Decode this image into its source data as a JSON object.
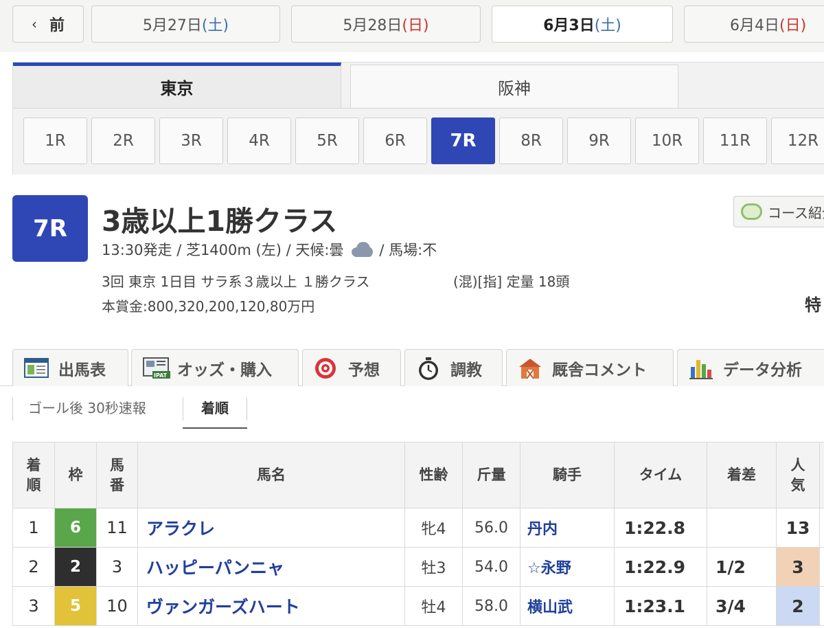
{
  "date_nav": {
    "prev_label": "前",
    "dates": [
      {
        "date": "5月27日",
        "day": "(土)",
        "day_type": "sat"
      },
      {
        "date": "5月28日",
        "day": "(日)",
        "day_type": "sun"
      },
      {
        "date": "6月3日",
        "day": "(土)",
        "day_type": "sat",
        "active": true
      },
      {
        "date": "6月4日",
        "day": "(日)",
        "day_type": "sun"
      }
    ]
  },
  "venues": [
    {
      "label": "東京",
      "active": true
    },
    {
      "label": "阪神",
      "active": false
    }
  ],
  "races": [
    "1R",
    "2R",
    "3R",
    "4R",
    "5R",
    "6R",
    "7R",
    "8R",
    "9R",
    "10R",
    "11R",
    "12R"
  ],
  "active_race": "7R",
  "race": {
    "number": "7R",
    "name": "3歳以上1勝クラス",
    "info_left": "13:30発走 / 芝1400m (左) / 天候:曇",
    "info_right": "/ 馬場:不",
    "detail": "3回 東京 1日目 サラ系３歳以上 １勝クラス",
    "detail_group": "(混)[指] 定量 18頭",
    "prize": "本賞金:800,320,200,120,80万円",
    "course_label": "コース紹介",
    "extra_label": "特",
    "weather_icon": "cloud-icon"
  },
  "function_tabs": [
    {
      "label": "出馬表",
      "icon": "card-icon"
    },
    {
      "label": "オッズ・購入",
      "icon": "ipat-icon"
    },
    {
      "label": "予想",
      "icon": "target-icon"
    },
    {
      "label": "調教",
      "icon": "stopwatch-icon"
    },
    {
      "label": "厩舎コメント",
      "icon": "stable-icon"
    },
    {
      "label": "データ分析",
      "icon": "bar-chart-icon"
    }
  ],
  "sub_tabs": {
    "first": "ゴール後 30秒速報",
    "second": "着順"
  },
  "table": {
    "headers": {
      "rank": "着\n順",
      "waku": "枠",
      "number": "馬\n番",
      "horse": "馬名",
      "sex_age": "性齢",
      "weight": "斤量",
      "jockey": "騎手",
      "time": "タイム",
      "margin": "着差",
      "popularity": "人\n気"
    },
    "rows": [
      {
        "rank": "1",
        "waku": "6",
        "waku_color": "#5aa64a",
        "number": "11",
        "horse": "アラクレ",
        "sex_age": "牝4",
        "weight": "56.0",
        "jockey": "丹内",
        "time": "1:22.8",
        "margin": "",
        "popularity": "13",
        "pop_bg": "#ffffff"
      },
      {
        "rank": "2",
        "waku": "2",
        "waku_color": "#2e2e2e",
        "number": "3",
        "horse": "ハッピーパンニャ",
        "sex_age": "牡3",
        "weight": "54.0",
        "jockey": "☆永野",
        "time": "1:22.9",
        "margin": "1/2",
        "popularity": "3",
        "pop_bg": "#f2d2b6"
      },
      {
        "rank": "3",
        "waku": "5",
        "waku_color": "#e2c238",
        "number": "10",
        "horse": "ヴァンガーズハート",
        "sex_age": "牡4",
        "weight": "58.0",
        "jockey": "横山武",
        "time": "1:23.1",
        "margin": "3/4",
        "popularity": "2",
        "pop_bg": "#cbd9f4"
      }
    ]
  }
}
